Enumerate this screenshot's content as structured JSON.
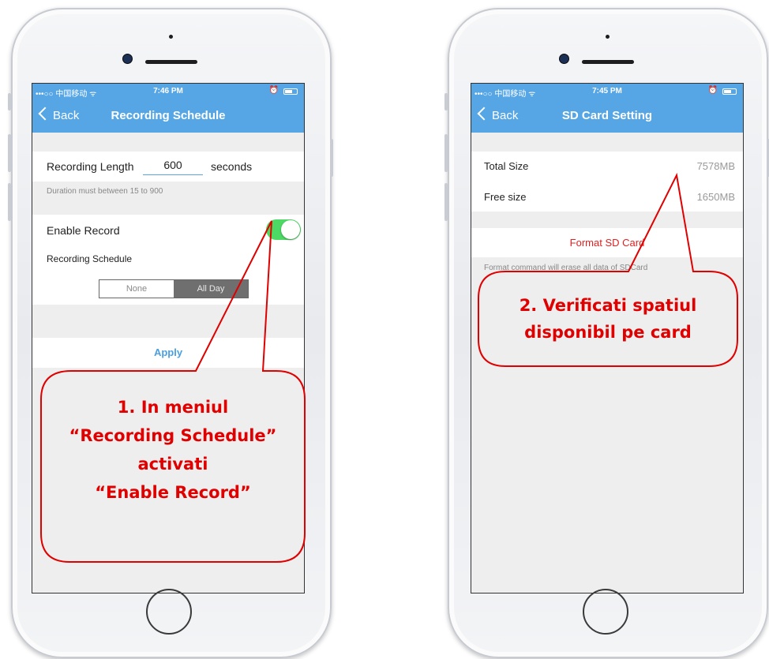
{
  "left_phone": {
    "status": {
      "carrier": "•••○○ 中国移动 ᯤ",
      "time": "7:46 PM"
    },
    "nav": {
      "back_label": "Back",
      "title": "Recording Schedule"
    },
    "recording_length": {
      "label": "Recording Length",
      "value": "600",
      "unit": "seconds"
    },
    "duration_note": "Duration must between 15 to 900",
    "enable_record": {
      "label": "Enable Record",
      "enabled": true
    },
    "schedule_label": "Recording Schedule",
    "schedule_options": [
      "None",
      "All Day"
    ],
    "schedule_selected": "All Day",
    "apply_label": "Apply"
  },
  "right_phone": {
    "status": {
      "carrier": "•••○○ 中国移动 ᯤ",
      "time": "7:45 PM"
    },
    "nav": {
      "back_label": "Back",
      "title": "SD Card Setting"
    },
    "total_size": {
      "label": "Total Size",
      "value": "7578MB"
    },
    "free_size": {
      "label": "Free size",
      "value": "1650MB"
    },
    "format_label": "Format SD Card",
    "format_note": "Format command will erase all data of SDCard"
  },
  "annotations": {
    "left": [
      "1. In meniul",
      "“Recording Schedule”",
      "activati",
      "“Enable Record”"
    ],
    "right": [
      "2. Verificati spatiul",
      "disponibil pe card"
    ]
  },
  "colors": {
    "accent": "#56a6e6",
    "annotation": "#e00000",
    "toggle_on": "#4cd964",
    "destructive": "#e02020"
  }
}
